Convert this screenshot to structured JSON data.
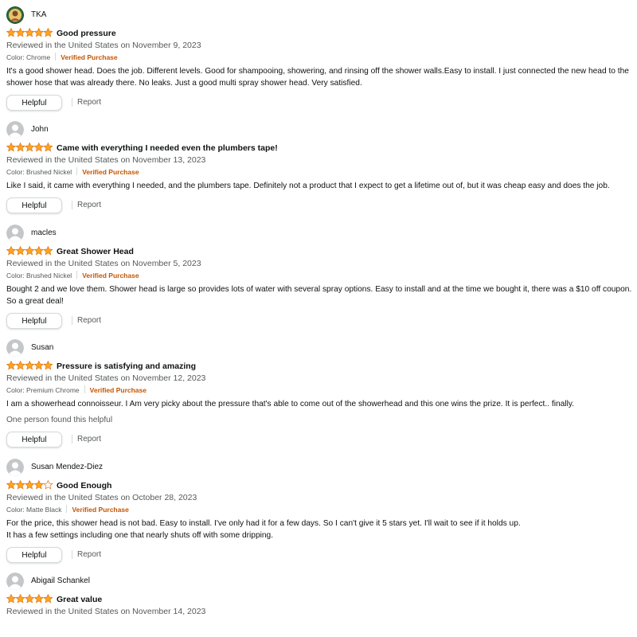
{
  "colors": {
    "star": "#FFA41C",
    "verified": "#C45500",
    "secondary_text": "#565959",
    "primary_text": "#0F1111"
  },
  "reviews": [
    {
      "author": "TKA",
      "avatar_icon": "custom-photo-avatar",
      "rating": 5,
      "title": "Good pressure",
      "reviewed": "Reviewed in the United States on November 9, 2023",
      "color": "Color: Chrome",
      "verified": "Verified Purchase",
      "body": "It's a good shower head. Does the job. Different levels. Good for shampooing, showering, and rinsing off the shower walls.Easy to install. I just connected the new head to the shower hose that was already there. No leaks. Just a good multi spray shower head. Very satisfied.",
      "helpful_label": "Helpful",
      "report_label": "Report"
    },
    {
      "author": "John",
      "avatar_icon": "default-user-avatar",
      "rating": 5,
      "title": "Came with everything I needed even the plumbers tape!",
      "reviewed": "Reviewed in the United States on November 13, 2023",
      "color": "Color: Brushed Nickel",
      "verified": "Verified Purchase",
      "body": "Like I said, it came with everything I needed, and the plumbers tape. Definitely not a product that I expect to get a lifetime out of, but it was cheap easy and does the job.",
      "helpful_label": "Helpful",
      "report_label": "Report"
    },
    {
      "author": "macles",
      "avatar_icon": "default-user-avatar",
      "rating": 5,
      "title": "Great Shower Head",
      "reviewed": "Reviewed in the United States on November 5, 2023",
      "color": "Color: Brushed Nickel",
      "verified": "Verified Purchase",
      "body": "Bought 2 and we love them. Shower head is large so provides lots of water with several spray options. Easy to install and at the time we bought it, there was a $10 off coupon. So a great deal!",
      "helpful_label": "Helpful",
      "report_label": "Report"
    },
    {
      "author": "Susan",
      "avatar_icon": "default-user-avatar",
      "rating": 5,
      "title": "Pressure is satisfying and amazing",
      "reviewed": "Reviewed in the United States on November 12, 2023",
      "color": "Color: Premium Chrome",
      "verified": "Verified Purchase",
      "body": "I am a showerhead connoisseur. I Am very picky about the pressure that's able to come out of the showerhead and this one wins the prize. It is perfect.. finally.",
      "helpful_count": "One person found this helpful",
      "helpful_label": "Helpful",
      "report_label": "Report"
    },
    {
      "author": "Susan Mendez-Diez",
      "avatar_icon": "default-user-avatar",
      "rating": 4,
      "title": "Good Enough",
      "reviewed": "Reviewed in the United States on October 28, 2023",
      "color": "Color: Matte Black",
      "verified": "Verified Purchase",
      "body_lines": [
        "For the price, this shower head is not bad. Easy to install. I've only had it for a few days. So I can't give it 5 stars yet. I'll wait to see if it holds up.",
        "It has a few settings including one that nearly shuts off with some dripping."
      ],
      "helpful_label": "Helpful",
      "report_label": "Report"
    },
    {
      "author": "Abigail Schankel",
      "avatar_icon": "default-user-avatar",
      "rating": 5,
      "title": "Great value",
      "reviewed": "Reviewed in the United States on November 14, 2023"
    }
  ]
}
